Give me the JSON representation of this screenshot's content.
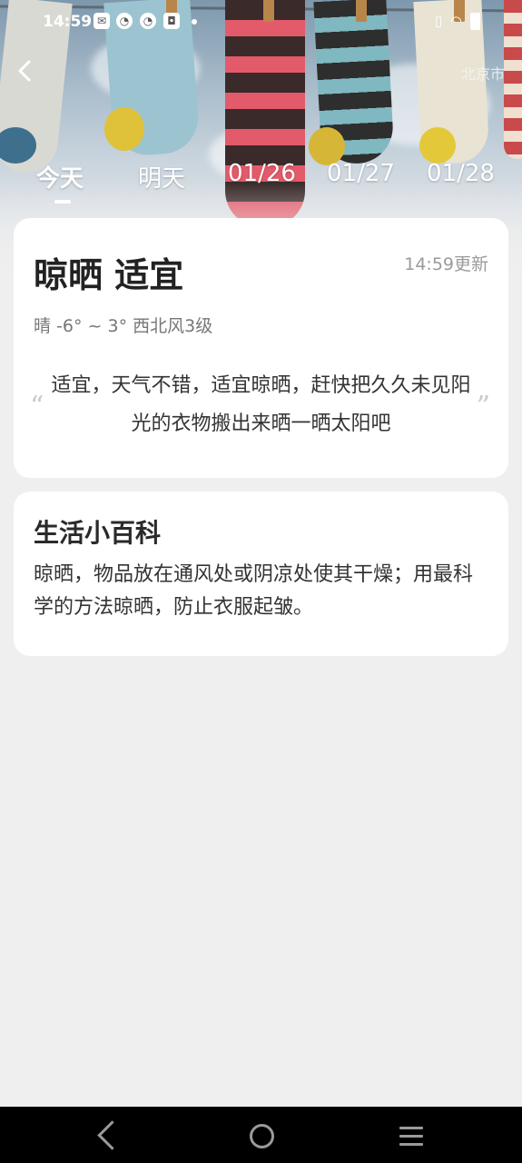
{
  "status_bar": {
    "time": "14:59"
  },
  "header": {
    "city": "北京市"
  },
  "tabs": [
    {
      "label": "今天",
      "active": true
    },
    {
      "label": "明天"
    },
    {
      "label": "01/26"
    },
    {
      "label": "01/27"
    },
    {
      "label": "01/28"
    }
  ],
  "drying_card": {
    "title": "晾晒 适宜",
    "update_time": "14:59更新",
    "weather": "晴 -6° ~ 3° 西北风3级",
    "advice": "适宜，天气不错，适宜晾晒，赶快把久久未见阳光的衣物搬出来晒一晒太阳吧"
  },
  "encyclopedia_card": {
    "title": "生活小百科",
    "text": "晾晒，物品放在通风处或阴凉处使其干燥；用最科学的方法晾晒，防止衣服起皱。"
  },
  "colors": {
    "background": "#efefef",
    "card": "#ffffff",
    "navbar": "#000000"
  }
}
